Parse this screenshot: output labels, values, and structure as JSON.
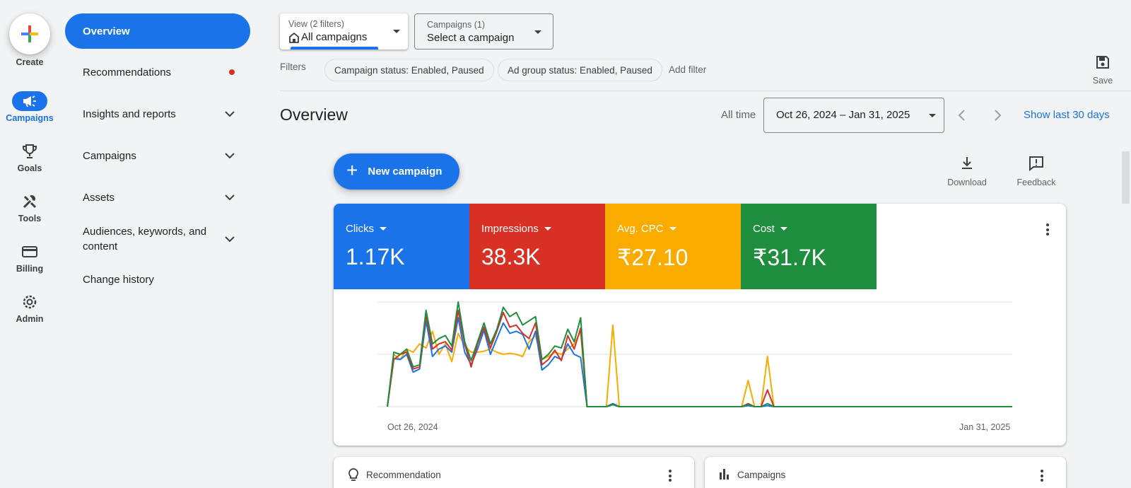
{
  "rail": {
    "create_label": "Create",
    "items": [
      {
        "label": "Campaigns",
        "icon": "megaphone-icon",
        "active": true
      },
      {
        "label": "Goals",
        "icon": "trophy-icon"
      },
      {
        "label": "Tools",
        "icon": "tools-icon"
      },
      {
        "label": "Billing",
        "icon": "credit-card-icon"
      },
      {
        "label": "Admin",
        "icon": "gear-icon"
      }
    ]
  },
  "subnav": {
    "items": [
      {
        "label": "Overview",
        "active": true
      },
      {
        "label": "Recommendations",
        "badge": "red-dot"
      },
      {
        "label": "Insights and reports",
        "expandable": true
      },
      {
        "label": "Campaigns",
        "expandable": true
      },
      {
        "label": "Assets",
        "expandable": true
      },
      {
        "label": "Audiences, keywords, and content",
        "expandable": true
      },
      {
        "label": "Change history"
      }
    ]
  },
  "topbar": {
    "view_small": "View (2 filters)",
    "view_big": "All campaigns",
    "campaigns_small": "Campaigns (1)",
    "campaigns_big": "Select a campaign",
    "filters_label": "Filters",
    "chips": [
      "Campaign status: Enabled, Paused",
      "Ad group status: Enabled, Paused"
    ],
    "add_filter": "Add filter",
    "save_label": "Save"
  },
  "header": {
    "title": "Overview",
    "all_time": "All time",
    "date_range": "Oct 26, 2024 – Jan 31, 2025",
    "show_last": "Show last 30 days"
  },
  "actions": {
    "new_campaign": "New campaign",
    "download": "Download",
    "feedback": "Feedback"
  },
  "metrics": [
    {
      "label": "Clicks",
      "value": "1.17K",
      "color": "#1a73e8"
    },
    {
      "label": "Impressions",
      "value": "38.3K",
      "color": "#d93025"
    },
    {
      "label": "Avg. CPC",
      "value": "₹27.10",
      "color": "#f9ab00"
    },
    {
      "label": "Cost",
      "value": "₹31.7K",
      "color": "#1e8e3e"
    }
  ],
  "chart_data": {
    "type": "line",
    "x_start_label": "Oct 26, 2024",
    "x_end_label": "Jan 31, 2025",
    "grid": true,
    "num_points": 98,
    "series": [
      {
        "name": "Clicks",
        "color": "#1a73e8",
        "values": [
          0,
          46,
          45,
          50,
          33,
          36,
          82,
          48,
          55,
          58,
          52,
          85,
          52,
          40,
          55,
          73,
          50,
          65,
          80,
          70,
          72,
          69,
          55,
          72,
          35,
          40,
          48,
          45,
          60,
          50,
          47,
          0,
          0,
          0,
          0,
          3,
          0,
          0,
          0,
          0,
          0,
          0,
          0,
          0,
          0,
          0,
          0,
          0,
          0,
          0,
          0,
          0,
          0,
          0,
          0,
          0,
          0,
          0,
          0,
          0,
          0,
          0,
          0,
          0,
          0,
          0,
          0,
          0,
          0,
          0,
          0,
          0,
          0,
          0,
          0,
          0,
          0,
          0,
          0,
          0,
          0,
          0,
          0,
          0,
          0,
          0,
          0,
          0,
          0,
          0,
          0,
          0,
          0,
          0,
          0,
          0,
          0,
          0
        ]
      },
      {
        "name": "Impressions",
        "color": "#d93025",
        "values": [
          0,
          45,
          50,
          52,
          36,
          38,
          88,
          55,
          60,
          62,
          54,
          92,
          60,
          38,
          60,
          76,
          56,
          72,
          90,
          76,
          78,
          70,
          65,
          80,
          40,
          45,
          54,
          44,
          68,
          55,
          75,
          0,
          0,
          0,
          0,
          2,
          0,
          0,
          0,
          0,
          0,
          0,
          0,
          0,
          0,
          0,
          0,
          0,
          0,
          0,
          0,
          0,
          0,
          0,
          0,
          0,
          0,
          0,
          0,
          0,
          0,
          0,
          0,
          0,
          0,
          0,
          0,
          0,
          0,
          0,
          0,
          0,
          0,
          0,
          0,
          0,
          0,
          0,
          0,
          0,
          0,
          0,
          0,
          0,
          0,
          0,
          0,
          0,
          0,
          0,
          0,
          0,
          0,
          0,
          0,
          0,
          0,
          0
        ]
      },
      {
        "name": "Avg. CPC",
        "color": "#f9ab00",
        "values": [
          0,
          50,
          45,
          55,
          52,
          60,
          56,
          72,
          50,
          60,
          43,
          70,
          58,
          52,
          52,
          53,
          55,
          52,
          50,
          51,
          50,
          48,
          62,
          68,
          45,
          48,
          52,
          50,
          55,
          60,
          72,
          0,
          0,
          0,
          0,
          78,
          0,
          0,
          0,
          0,
          0,
          0,
          0,
          0,
          0,
          0,
          0,
          0,
          0,
          0,
          0,
          0,
          0,
          0,
          0,
          0,
          0,
          0,
          0,
          0,
          0,
          0,
          0,
          0,
          0,
          0,
          0,
          0,
          0,
          0,
          0,
          0,
          0,
          0,
          0,
          0,
          0,
          0,
          0,
          0,
          0,
          0,
          0,
          0,
          0,
          0,
          0,
          0,
          0,
          0,
          0,
          0,
          0,
          0,
          0,
          0,
          0,
          0
        ]
      },
      {
        "name": "Cost",
        "color": "#1e8e3e",
        "values": [
          0,
          52,
          50,
          55,
          38,
          40,
          92,
          60,
          65,
          68,
          58,
          100,
          62,
          44,
          62,
          80,
          60,
          74,
          95,
          86,
          90,
          78,
          82,
          86,
          45,
          50,
          58,
          56,
          74,
          62,
          85,
          0,
          0,
          0,
          0,
          2,
          0,
          0,
          0,
          0,
          0,
          0,
          0,
          0,
          0,
          0,
          0,
          0,
          0,
          0,
          0,
          0,
          0,
          0,
          0,
          0,
          0,
          0,
          0,
          0,
          0,
          0,
          0,
          0,
          0,
          0,
          0,
          0,
          0,
          0,
          0,
          0,
          0,
          0,
          0,
          0,
          0,
          0,
          0,
          0,
          0,
          0,
          0,
          0,
          0,
          0,
          0,
          0,
          0,
          0,
          0,
          0,
          0,
          0,
          0,
          0,
          0,
          0
        ]
      }
    ],
    "spikes": [
      {
        "index": 56,
        "cpc": 25,
        "impr": 3,
        "cost": 2,
        "clicks": 1
      },
      {
        "index": 59,
        "cpc": 48,
        "impr": 16,
        "cost": 3,
        "clicks": 1
      }
    ],
    "ylim": [
      0,
      100
    ]
  },
  "bottom_cards": [
    {
      "title": "Recommendation",
      "icon": "lightbulb-icon"
    },
    {
      "title": "Campaigns",
      "icon": "bar-chart-icon"
    }
  ]
}
